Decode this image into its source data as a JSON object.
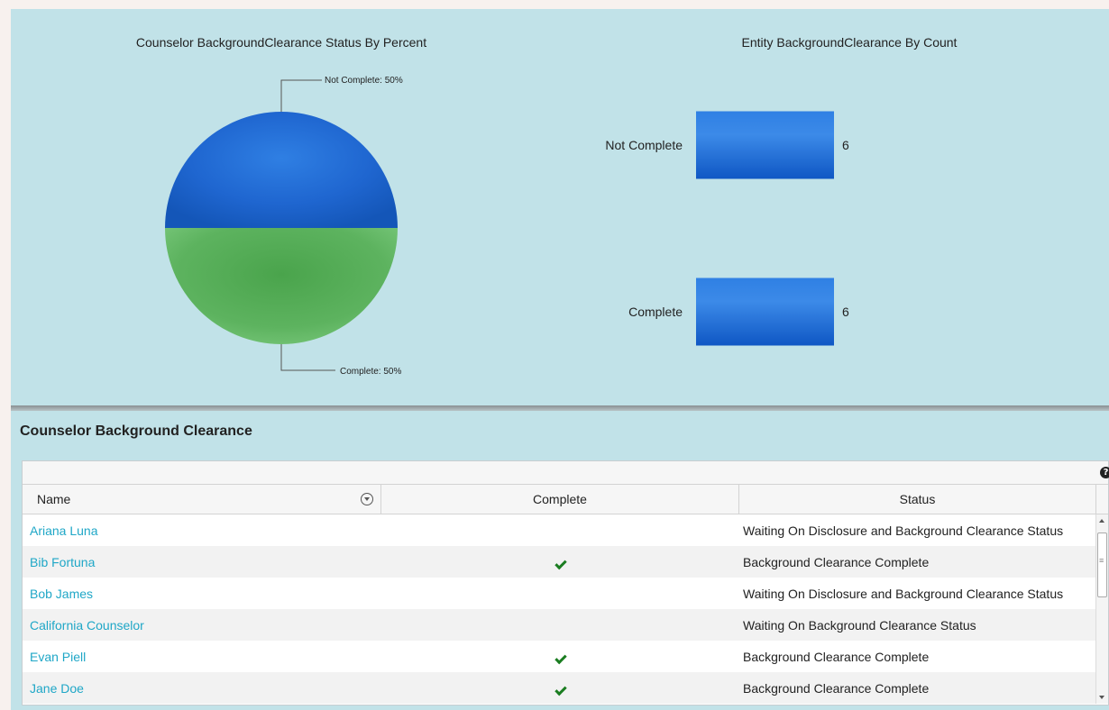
{
  "charts": [
    {
      "title": "Counselor BackgroundClearance Status By Percent",
      "chart_data": {
        "type": "pie",
        "title": "Counselor BackgroundClearance Status By Percent",
        "labels": [
          "Not Complete",
          "Complete"
        ],
        "values": [
          50,
          50
        ],
        "unit": "%",
        "colors": [
          "#1f66d0",
          "#4ca64e"
        ]
      },
      "annotations": [
        "Not Complete: 50%",
        "Complete: 50%"
      ]
    },
    {
      "title": "Entity BackgroundClearance By Count",
      "chart_data": {
        "type": "bar",
        "orientation": "horizontal",
        "title": "Entity BackgroundClearance By Count",
        "categories": [
          "Not Complete",
          "Complete"
        ],
        "values": [
          6,
          6
        ],
        "colors": [
          "#1f66d0"
        ]
      }
    }
  ],
  "grid": {
    "title": "Counselor Background Clearance",
    "columns": [
      "Name",
      "Complete",
      "Status"
    ],
    "help_icon": "help-icon",
    "rows": [
      {
        "name": "Ariana Luna",
        "complete": false,
        "status": "Waiting On Disclosure and Background Clearance Status"
      },
      {
        "name": "Bib Fortuna",
        "complete": true,
        "status": "Background Clearance Complete"
      },
      {
        "name": "Bob James",
        "complete": false,
        "status": "Waiting On Disclosure and Background Clearance Status"
      },
      {
        "name": "California Counselor",
        "complete": false,
        "status": "Waiting On Background Clearance Status"
      },
      {
        "name": "Evan Piell",
        "complete": true,
        "status": "Background Clearance Complete"
      },
      {
        "name": "Jane Doe",
        "complete": true,
        "status": "Background Clearance Complete"
      }
    ]
  }
}
